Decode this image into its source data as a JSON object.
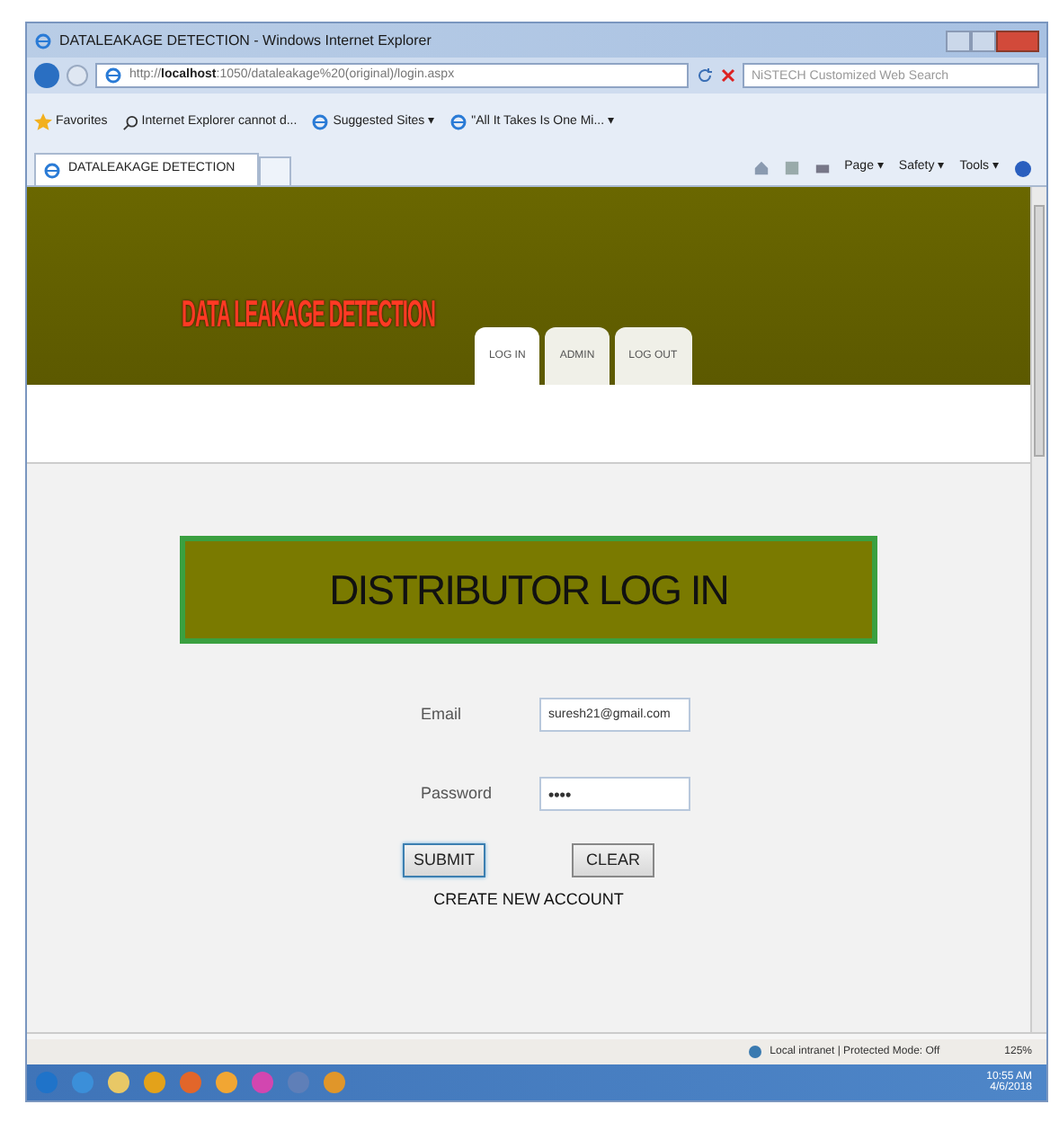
{
  "window": {
    "title": "DATALEAKAGE DETECTION - Windows Internet Explorer"
  },
  "address_bar": {
    "url_prefix": "http://",
    "url_host": "localhost",
    "url_rest": ":1050/dataleakage%20(original)/login.aspx"
  },
  "search": {
    "placeholder": "NiSTECH Customized Web Search"
  },
  "favorites_bar": {
    "items": [
      {
        "label": "Favorites",
        "kind": "star"
      },
      {
        "label": "Internet Explorer cannot d...",
        "kind": "search"
      },
      {
        "label": "Suggested Sites ▾",
        "kind": "ie"
      },
      {
        "label": "\"All It Takes Is One Mi... ▾",
        "kind": "ie"
      }
    ]
  },
  "browser_tab": {
    "title": "DATALEAKAGE DETECTION"
  },
  "command_bar": [
    "Page ▾",
    "Safety ▾",
    "Tools ▾"
  ],
  "site": {
    "logo": "DATA LEAKAGE DETECTION",
    "nav": [
      {
        "label": "LOG IN",
        "selected": true
      },
      {
        "label": "ADMIN",
        "selected": false
      },
      {
        "label": "LOG OUT",
        "selected": false
      }
    ]
  },
  "login": {
    "heading": "DISTRIBUTOR LOG IN",
    "fields": [
      {
        "label": "Email",
        "value": "suresh21@gmail.com",
        "kind": "text"
      },
      {
        "label": "Password",
        "value": "••••",
        "kind": "password"
      }
    ],
    "buttons": [
      {
        "label": "SUBMIT",
        "selected": true
      },
      {
        "label": "CLEAR",
        "selected": false
      }
    ],
    "link": "CREATE NEW ACCOUNT"
  },
  "status_bar": {
    "zone": "Local intranet | Protected Mode: Off",
    "zoom": "125%"
  },
  "taskbar": {
    "time": "10:55 AM",
    "date": "4/6/2018"
  }
}
